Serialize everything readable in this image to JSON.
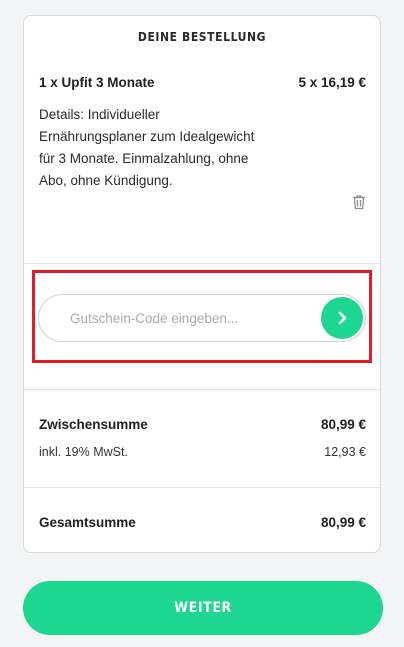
{
  "order": {
    "title": "DEINE BESTELLUNG",
    "item": {
      "name": "1 x Upfit 3 Monate",
      "price": "5 x 16,19 €",
      "details": "Details: Individueller Ernährungsplaner zum Idealgewicht für 3 Monate. Einmalzahlung, ohne Abo, ohne Kündigung.",
      "delete_icon": "trash-icon"
    }
  },
  "coupon": {
    "placeholder": "Gutschein-Code eingeben...",
    "value": "",
    "submit_icon": "chevron-right-icon"
  },
  "totals": {
    "subtotal_label": "Zwischensumme",
    "subtotal_value": "80,99 €",
    "vat_label": "inkl. 19% MwSt.",
    "vat_value": "12,93 €",
    "total_label": "Gesamtsumme",
    "total_value": "80,99 €"
  },
  "actions": {
    "continue_label": "WEITER"
  },
  "colors": {
    "accent": "#1dd68f",
    "highlight": "#e31b23",
    "background": "#f3f4f5"
  }
}
